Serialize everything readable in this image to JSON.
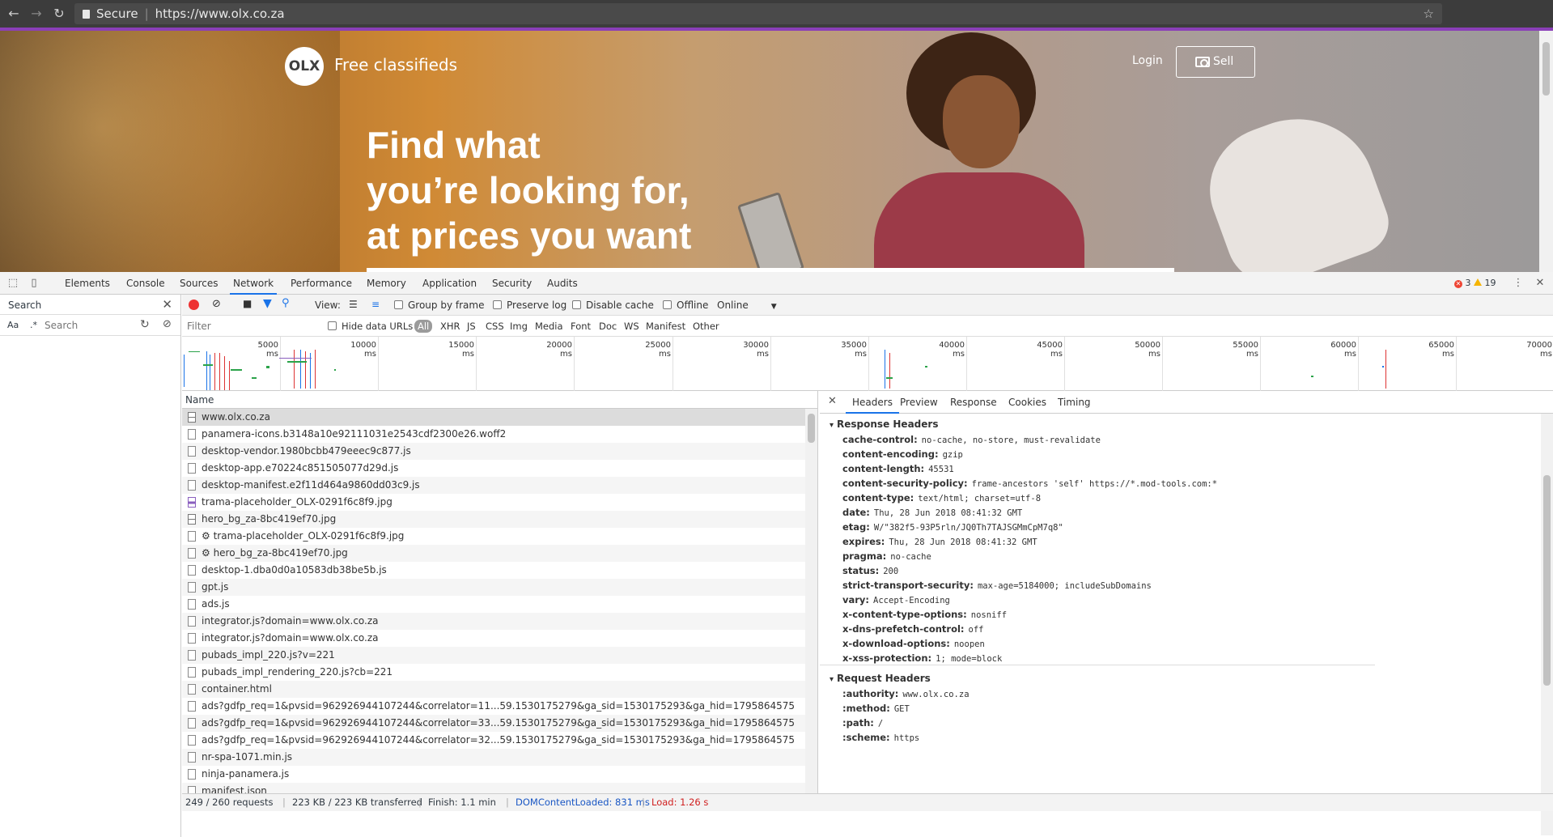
{
  "browser": {
    "secure_label": "Secure",
    "url": "https://www.olx.co.za"
  },
  "page": {
    "logo_text": "OLX",
    "tagline": "Free classifieds",
    "login": "Login",
    "sell": "Sell",
    "headline_1": "Find what",
    "headline_2": "you’re looking for,",
    "headline_3": "at prices you want"
  },
  "devtools": {
    "tabs": [
      "Elements",
      "Console",
      "Sources",
      "Network",
      "Performance",
      "Memory",
      "Application",
      "Security",
      "Audits"
    ],
    "active_tab": "Network",
    "error_count": "3",
    "warning_count": "19",
    "search": {
      "title": "Search",
      "case_label": "Aa",
      "regex_label": ".*",
      "placeholder": "Search"
    },
    "toolbar": {
      "view_label": "View:",
      "group_by_frame": "Group by frame",
      "preserve_log": "Preserve log",
      "disable_cache": "Disable cache",
      "offline": "Offline",
      "throttle": "Online"
    },
    "filter": {
      "placeholder": "Filter",
      "hide_data_urls": "Hide data URLs",
      "types": [
        "All",
        "XHR",
        "JS",
        "CSS",
        "Img",
        "Media",
        "Font",
        "Doc",
        "WS",
        "Manifest",
        "Other"
      ]
    },
    "timeline_labels": [
      "5000 ms",
      "10000 ms",
      "15000 ms",
      "20000 ms",
      "25000 ms",
      "30000 ms",
      "35000 ms",
      "40000 ms",
      "45000 ms",
      "50000 ms",
      "55000 ms",
      "60000 ms",
      "65000 ms",
      "70000 ms"
    ],
    "list_header": "Name",
    "requests": [
      {
        "name": "www.olx.co.za",
        "icon": "doc-icon"
      },
      {
        "name": "panamera-icons.b3148a10e92111031e2543cdf2300e26.woff2",
        "icon": "file-icon"
      },
      {
        "name": "desktop-vendor.1980bcbb479eeec9c877.js",
        "icon": "file-icon"
      },
      {
        "name": "desktop-app.e70224c851505077d29d.js",
        "icon": "file-icon"
      },
      {
        "name": "desktop-manifest.e2f11d464a9860dd03c9.js",
        "icon": "file-icon"
      },
      {
        "name": "trama-placeholder_OLX-0291f6c8f9.jpg",
        "icon": "image-icon"
      },
      {
        "name": "hero_bg_za-8bc419ef70.jpg",
        "icon": "doc-icon"
      },
      {
        "name": "⚙ trama-placeholder_OLX-0291f6c8f9.jpg",
        "icon": "file-icon"
      },
      {
        "name": "⚙ hero_bg_za-8bc419ef70.jpg",
        "icon": "file-icon"
      },
      {
        "name": "desktop-1.dba0d0a10583db38be5b.js",
        "icon": "file-icon"
      },
      {
        "name": "gpt.js",
        "icon": "file-icon"
      },
      {
        "name": "ads.js",
        "icon": "file-icon"
      },
      {
        "name": "integrator.js?domain=www.olx.co.za",
        "icon": "file-icon"
      },
      {
        "name": "integrator.js?domain=www.olx.co.za",
        "icon": "file-icon"
      },
      {
        "name": "pubads_impl_220.js?v=221",
        "icon": "file-icon"
      },
      {
        "name": "pubads_impl_rendering_220.js?cb=221",
        "icon": "file-icon"
      },
      {
        "name": "container.html",
        "icon": "file-icon"
      },
      {
        "name": "ads?gdfp_req=1&pvsid=962926944107244&correlator=11...59.1530175279&ga_sid=1530175293&ga_hid=1795864575",
        "icon": "file-icon"
      },
      {
        "name": "ads?gdfp_req=1&pvsid=962926944107244&correlator=33...59.1530175279&ga_sid=1530175293&ga_hid=1795864575",
        "icon": "file-icon"
      },
      {
        "name": "ads?gdfp_req=1&pvsid=962926944107244&correlator=32...59.1530175279&ga_sid=1530175293&ga_hid=1795864575",
        "icon": "file-icon"
      },
      {
        "name": "nr-spa-1071.min.js",
        "icon": "file-icon"
      },
      {
        "name": "ninja-panamera.js",
        "icon": "file-icon"
      },
      {
        "name": "manifest.json",
        "icon": "file-icon"
      }
    ],
    "detail_tabs": [
      "Headers",
      "Preview",
      "Response",
      "Cookies",
      "Timing"
    ],
    "active_detail_tab": "Headers",
    "response_headers_title": "Response Headers",
    "response_headers": [
      {
        "k": "cache-control:",
        "v": "no-cache, no-store, must-revalidate"
      },
      {
        "k": "content-encoding:",
        "v": "gzip"
      },
      {
        "k": "content-length:",
        "v": "45531"
      },
      {
        "k": "content-security-policy:",
        "v": "frame-ancestors 'self' https://*.mod-tools.com:*"
      },
      {
        "k": "content-type:",
        "v": "text/html; charset=utf-8"
      },
      {
        "k": "date:",
        "v": "Thu, 28 Jun 2018 08:41:32 GMT"
      },
      {
        "k": "etag:",
        "v": "W/\"382f5-93P5rln/JQ0Th7TAJSGMmCpM7q8\""
      },
      {
        "k": "expires:",
        "v": "Thu, 28 Jun 2018 08:41:32 GMT"
      },
      {
        "k": "pragma:",
        "v": "no-cache"
      },
      {
        "k": "status:",
        "v": "200"
      },
      {
        "k": "strict-transport-security:",
        "v": "max-age=5184000; includeSubDomains"
      },
      {
        "k": "vary:",
        "v": "Accept-Encoding"
      },
      {
        "k": "x-content-type-options:",
        "v": "nosniff"
      },
      {
        "k": "x-dns-prefetch-control:",
        "v": "off"
      },
      {
        "k": "x-download-options:",
        "v": "noopen"
      },
      {
        "k": "x-xss-protection:",
        "v": "1; mode=block"
      }
    ],
    "request_headers_title": "Request Headers",
    "request_headers": [
      {
        "k": ":authority:",
        "v": "www.olx.co.za"
      },
      {
        "k": ":method:",
        "v": "GET"
      },
      {
        "k": ":path:",
        "v": "/"
      },
      {
        "k": ":scheme:",
        "v": "https"
      }
    ],
    "status": {
      "requests": "249 / 260 requests",
      "transferred": "223 KB / 223 KB transferred",
      "finish": "Finish: 1.1 min",
      "dom": "DOMContentLoaded: 831 ms",
      "load": "Load: 1.26 s"
    }
  },
  "colors": {
    "accent": "#1a73e8",
    "record": "#e33",
    "purple_bar": "#8a3fb8"
  }
}
